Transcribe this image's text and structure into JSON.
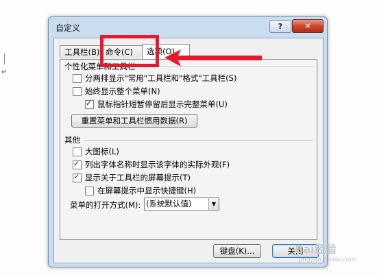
{
  "dialog": {
    "title": "自定义",
    "help_label": "?",
    "close_label": "✕"
  },
  "tabs": [
    {
      "label": "工具栏(B)"
    },
    {
      "label": "命令(C)"
    },
    {
      "label": "选项(O)"
    }
  ],
  "personalized": {
    "title": "个性化菜单和工具栏",
    "items": [
      {
        "label": "分两排显示\"常用\"工具栏和\"格式\"工具栏(S)",
        "checked": false
      },
      {
        "label": "始终显示整个菜单(N)",
        "checked": false
      },
      {
        "label": "鼠标指针短暂停留后显示完整菜单(U)",
        "checked": true
      }
    ],
    "reset_button": "重置菜单和工具栏惯用数据(R)"
  },
  "other": {
    "title": "其他",
    "items": [
      {
        "label": "大图标(L)",
        "checked": false
      },
      {
        "label": "列出字体名称时显示该字体的实际外观(F)",
        "checked": true
      },
      {
        "label": "显示关于工具栏的屏幕提示(T)",
        "checked": true
      },
      {
        "label": "在屏幕提示中显示快捷键(H)",
        "checked": false
      }
    ],
    "menu_animation_label": "菜单的打开方式(M):",
    "menu_animation_value": "(系统默认值)"
  },
  "footer": {
    "keyboard_button": "键盘(K)...",
    "close_button": "关闭"
  },
  "watermark": {
    "text": "Bai经验",
    "sub": "jingyan.baidu.com"
  },
  "colors": {
    "annotation_red": "#e8192c",
    "dialog_frame": "#c9dcf0"
  }
}
